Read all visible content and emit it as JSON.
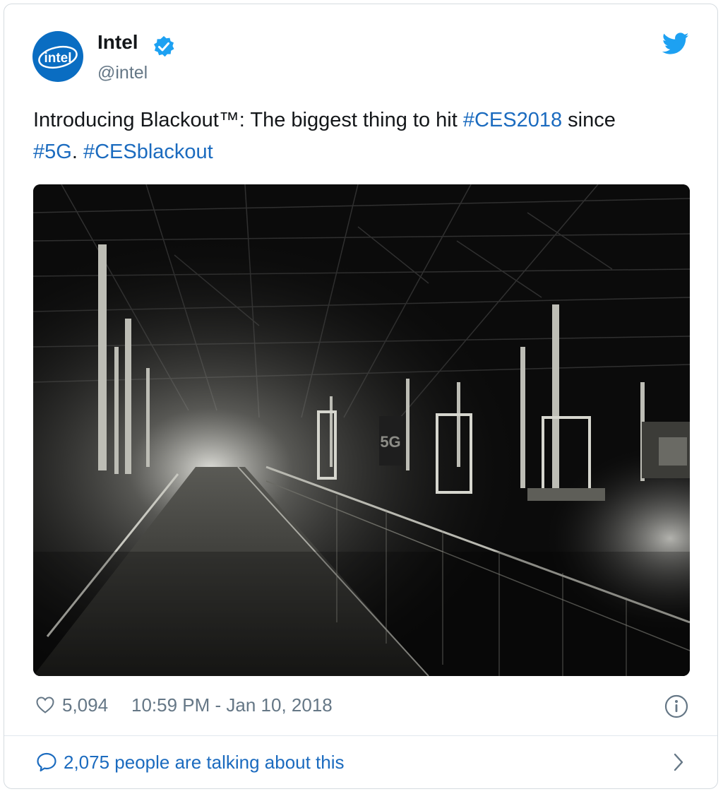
{
  "author": {
    "avatar_text": "intel",
    "name": "Intel",
    "handle": "@intel"
  },
  "tweet": {
    "text_part1": "Introducing Blackout™: The biggest thing to hit ",
    "hashtag1": "#CES2018",
    "text_part2": " since ",
    "hashtag2": "#5G",
    "text_part3": ". ",
    "hashtag3": "#CESblackout"
  },
  "media": {
    "sign_text": "5G"
  },
  "footer": {
    "likes": "5,094",
    "timestamp": "10:59 PM - Jan 10, 2018"
  },
  "conversation": {
    "label": "2,075 people are talking about this"
  },
  "colors": {
    "link": "#1b6bbf",
    "twitter_blue": "#1da1f2",
    "intel_blue": "#0a6dc2",
    "muted": "#657786"
  },
  "icons": [
    "verified-badge-icon",
    "twitter-bird-icon",
    "heart-icon",
    "info-icon",
    "speech-bubble-icon",
    "chevron-right-icon"
  ]
}
